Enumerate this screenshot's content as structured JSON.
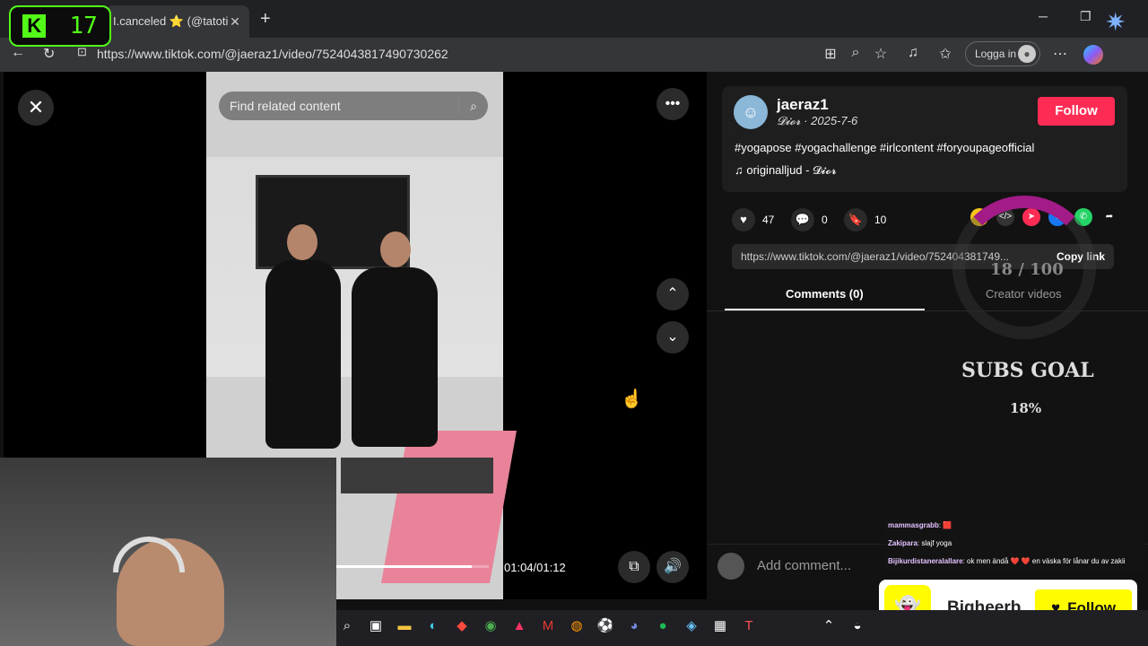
{
  "overlay": {
    "kick_count": "17"
  },
  "browser": {
    "tab_title": "I.canceled ⭐ (@tatoti...",
    "tab_close": "✕",
    "new_tab": "+",
    "url": "https://www.tiktok.com/@jaeraz1/video/7524043817490730262",
    "login_label": "Logga in"
  },
  "video": {
    "search_placeholder": "Find related content",
    "time": "01:04/01:12",
    "progress": 0.89
  },
  "post": {
    "username": "jaeraz1",
    "display_date": "𝓓𝓲𝓸𝓻 · 2025-7-6",
    "follow_label": "Follow",
    "hashtags": "#yogapose #yogachallenge #irlcontent #foryoupageofficial",
    "music": "originalljud - 𝓓𝓲𝓸𝓻",
    "likes": "47",
    "comments": "0",
    "saves": "10",
    "link": "https://www.tiktok.com/@jaeraz1/video/752404381749...",
    "copy_link": "Copy link",
    "tab_comments": "Comments (0)",
    "tab_creator": "Creator videos",
    "add_comment": "Add comment..."
  },
  "subs_goal": {
    "count": "18 / 100",
    "title": "SUBS GOAL",
    "percent": "18%",
    "progress": 0.18
  },
  "chat": [
    {
      "user": "mammasgrabb",
      "text": ": 🟥"
    },
    {
      "user": "Zakipara",
      "text": ": slajf yoga"
    },
    {
      "user": "Bijikurdistaneralallare",
      "text": ": ok men ändå ❤️ ❤️ en väska för lånar du av zakii"
    }
  ],
  "snap_follow": {
    "name": "Bigheerb",
    "button": "Follow"
  },
  "colors": {
    "tiktok_red": "#fe2c55",
    "kick_green": "#53fc18",
    "snap_yellow": "#fffc00",
    "goal_purple": "#a21b86"
  }
}
